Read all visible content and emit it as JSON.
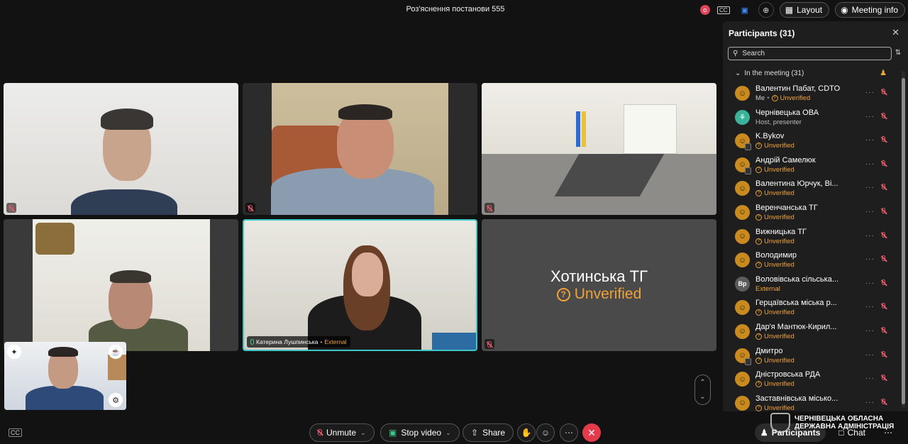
{
  "meeting": {
    "title": "Роз'яснення постанови 555"
  },
  "topbar": {
    "rec_badge": "o",
    "cc_label": "CC",
    "layout_label": "Layout",
    "meeting_info_label": "Meeting info"
  },
  "tiles": {
    "center_name": "Катерина Лушпинська",
    "center_tag": "External",
    "unverified_name": "Хотинська ТГ",
    "unverified_status": "Unverified"
  },
  "toolbar": {
    "cc_label": "CC",
    "unmute_label": "Unmute",
    "stop_video_label": "Stop video",
    "share_label": "Share",
    "participants_label": "Participants",
    "chat_label": "Chat"
  },
  "watermark": {
    "line1": "ЧЕРНІВЕЦЬКА ОБЛАСНА",
    "line2": "ДЕРЖАВНА АДМІНІСТРАЦІЯ"
  },
  "panel": {
    "title": "Participants (31)",
    "search_placeholder": "Search",
    "section_label": "In the meeting (31)",
    "participants": [
      {
        "name": "Валентин Пабат, CDTO",
        "prefix": "Me",
        "status": "Unverified",
        "avatar": "person",
        "phone": false
      },
      {
        "name": "Чернівецька ОВА",
        "prefix": "",
        "status": "Host, presenter",
        "avatar": "host",
        "phone": false
      },
      {
        "name": "K.Bykov",
        "prefix": "",
        "status": "Unverified",
        "avatar": "person",
        "phone": true
      },
      {
        "name": "Андрій Самелюк",
        "prefix": "",
        "status": "Unverified",
        "avatar": "person",
        "phone": true
      },
      {
        "name": "Валентина Юрчук, Ві...",
        "prefix": "",
        "status": "Unverified",
        "avatar": "person",
        "phone": false
      },
      {
        "name": "Веренчанська ТГ",
        "prefix": "",
        "status": "Unverified",
        "avatar": "person",
        "phone": false
      },
      {
        "name": "Вижницька ТГ",
        "prefix": "",
        "status": "Unverified",
        "avatar": "person",
        "phone": false
      },
      {
        "name": "Володимир",
        "prefix": "",
        "status": "Unverified",
        "avatar": "person",
        "phone": false
      },
      {
        "name": "Воловівська сільська...",
        "prefix": "",
        "status": "External",
        "avatar": "Вр",
        "phone": false
      },
      {
        "name": "Герцаївська міська р...",
        "prefix": "",
        "status": "Unverified",
        "avatar": "person",
        "phone": false
      },
      {
        "name": "Дар'я Мантюк-Кирил...",
        "prefix": "",
        "status": "Unverified",
        "avatar": "person",
        "phone": false
      },
      {
        "name": "Дмитро",
        "prefix": "",
        "status": "Unverified",
        "avatar": "person",
        "phone": true
      },
      {
        "name": "Дністровська РДА",
        "prefix": "",
        "status": "Unverified",
        "avatar": "person",
        "phone": false
      },
      {
        "name": "Заставнівська місько...",
        "prefix": "",
        "status": "Unverified",
        "avatar": "person",
        "phone": false
      }
    ]
  },
  "colors": {
    "background": "#121212",
    "unverified": "#f0a23a",
    "end_call": "#e33b4b",
    "host_avatar": "#3ab39a",
    "active_tile_border": "#3ec7c7"
  }
}
